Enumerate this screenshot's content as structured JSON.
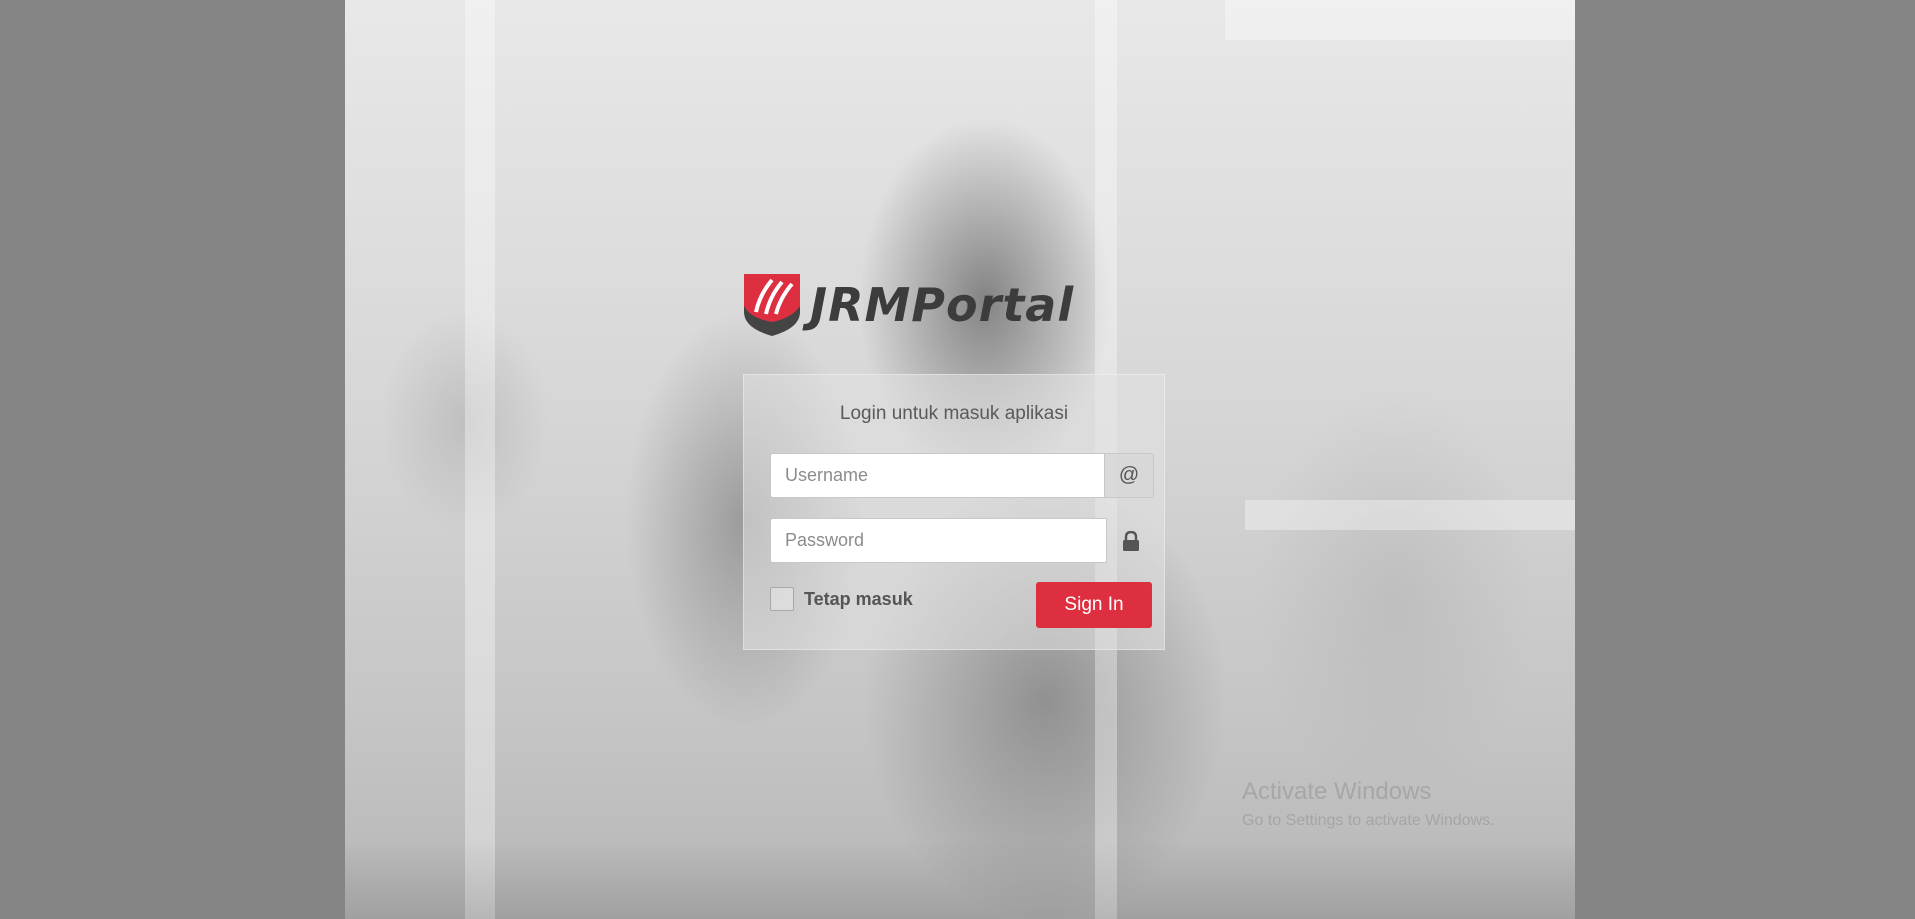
{
  "brand": {
    "name": "JRMPortal",
    "colors": {
      "accent": "#dd2f40",
      "wordmark": "#3c3c3c",
      "shield_dark": "#444444"
    },
    "logo_icon": "shield-logo-icon"
  },
  "login": {
    "title": "Login untuk masuk aplikasi",
    "username": {
      "placeholder": "Username",
      "value": "",
      "addon_symbol": "@",
      "addon_icon": "at-icon"
    },
    "password": {
      "placeholder": "Password",
      "value": "",
      "addon_icon": "lock-icon"
    },
    "remember_label": "Tetap masuk",
    "remember_checked": false,
    "submit_label": "Sign In"
  },
  "os_watermark": {
    "title": "Activate Windows",
    "subtitle": "Go to Settings to activate Windows."
  }
}
